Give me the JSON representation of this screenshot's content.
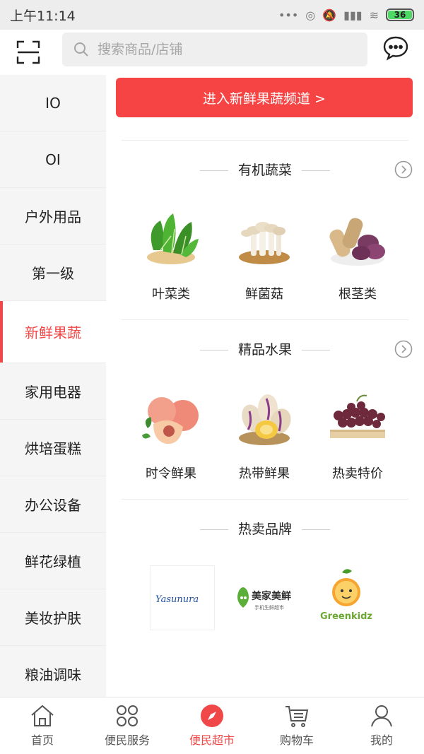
{
  "status_bar": {
    "time": "上午11:14",
    "battery": "36"
  },
  "search": {
    "placeholder": "搜索商品/店铺"
  },
  "sidebar": {
    "items": [
      {
        "label": "IO"
      },
      {
        "label": "OI"
      },
      {
        "label": "户外用品"
      },
      {
        "label": "第一级"
      },
      {
        "label": "新鲜果蔬",
        "active": true
      },
      {
        "label": "家用电器"
      },
      {
        "label": "烘培蛋糕"
      },
      {
        "label": "办公设备"
      },
      {
        "label": "鲜花绿植"
      },
      {
        "label": "美妆护肤"
      },
      {
        "label": "粮油调味"
      }
    ]
  },
  "main": {
    "banner_label": "进入新鲜果蔬频道 >",
    "sections": [
      {
        "title": "有机蔬菜",
        "items": [
          {
            "label": "叶菜类",
            "icon": "leafy-greens-icon"
          },
          {
            "label": "鲜菌菇",
            "icon": "mushroom-icon"
          },
          {
            "label": "根茎类",
            "icon": "root-vegetable-icon"
          }
        ]
      },
      {
        "title": "精品水果",
        "items": [
          {
            "label": "时令鲜果",
            "icon": "peach-icon"
          },
          {
            "label": "热带鲜果",
            "icon": "pepino-icon"
          },
          {
            "label": "热卖特价",
            "icon": "grape-icon"
          }
        ]
      },
      {
        "title": "热卖品牌",
        "brands": [
          {
            "text": "Yasunura"
          },
          {
            "text": "美家美鲜",
            "subtext": "手机生鲜超市"
          },
          {
            "text": "Greenkidz"
          }
        ]
      }
    ]
  },
  "tabbar": {
    "tabs": [
      {
        "label": "首页"
      },
      {
        "label": "便民服务"
      },
      {
        "label": "便民超市",
        "active": true
      },
      {
        "label": "购物车"
      },
      {
        "label": "我的"
      }
    ]
  },
  "colors": {
    "accent": "#f04848",
    "banner": "#f64444"
  }
}
